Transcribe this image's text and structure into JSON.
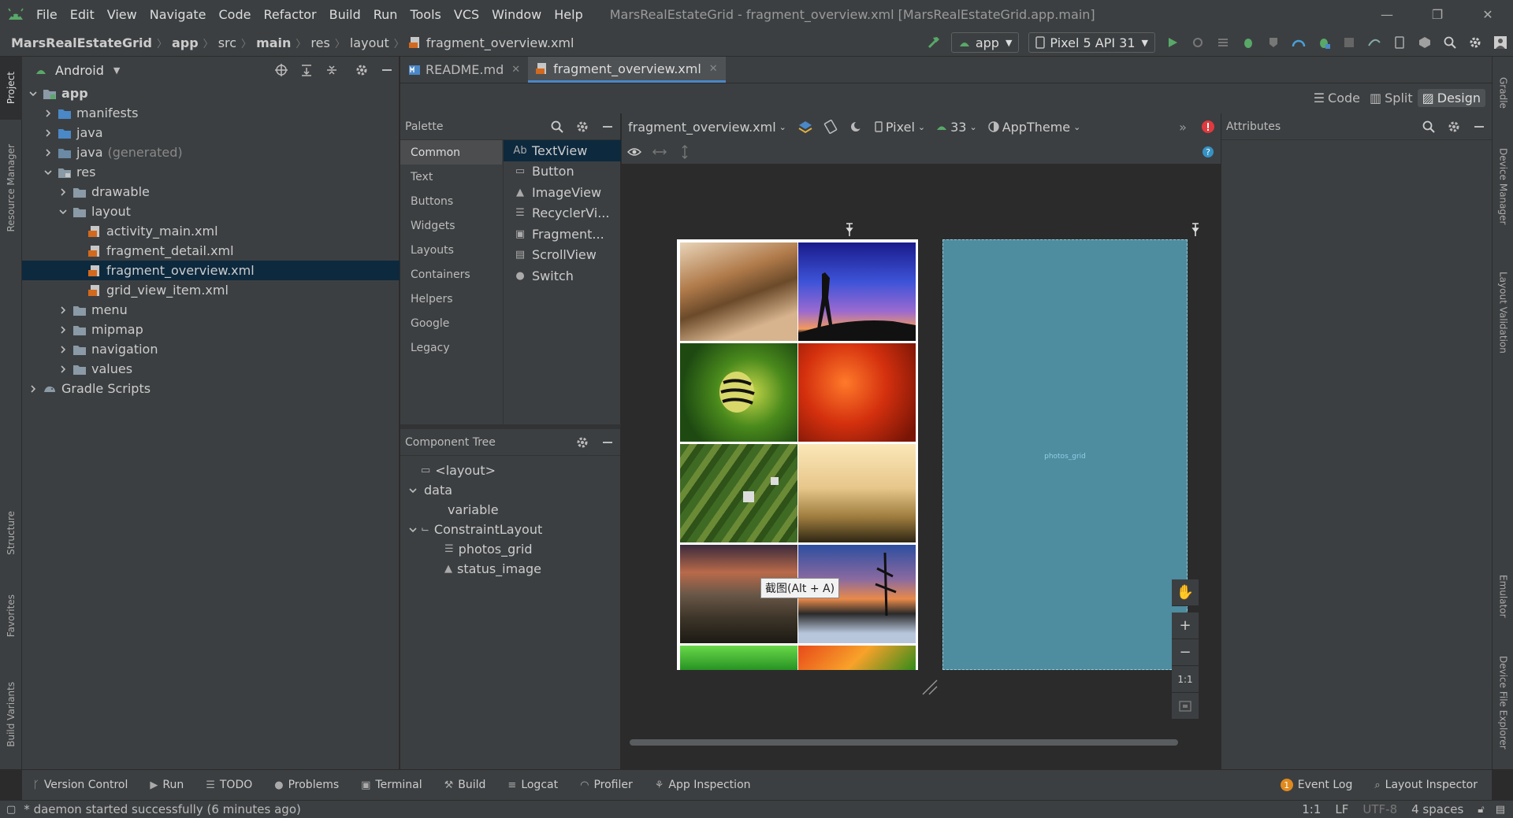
{
  "window": {
    "title": "MarsRealEstateGrid - fragment_overview.xml [MarsRealEstateGrid.app.main]",
    "menu": [
      "File",
      "Edit",
      "View",
      "Navigate",
      "Code",
      "Refactor",
      "Build",
      "Run",
      "Tools",
      "VCS",
      "Window",
      "Help"
    ],
    "controls": [
      "—",
      "❐",
      "✕"
    ]
  },
  "breadcrumbs": [
    "MarsRealEstateGrid",
    "app",
    "src",
    "main",
    "res",
    "layout",
    "fragment_overview.xml"
  ],
  "toolbar": {
    "run_config": "app",
    "device": "Pixel 5 API 31"
  },
  "left_stripe": [
    "Project",
    "Resource Manager",
    "Structure",
    "Favorites",
    "Build Variants"
  ],
  "right_stripe": [
    "Gradle",
    "Device Manager",
    "Layout Validation",
    "Emulator",
    "Device File Explorer"
  ],
  "project": {
    "view": "Android",
    "tree": [
      {
        "label": "app",
        "level": 0,
        "expanded": true,
        "kind": "module"
      },
      {
        "label": "manifests",
        "level": 1,
        "expanded": false,
        "kind": "folder-blue"
      },
      {
        "label": "java",
        "level": 1,
        "expanded": false,
        "kind": "folder-blue"
      },
      {
        "label": "java",
        "suffix": "(generated)",
        "level": 1,
        "expanded": false,
        "kind": "folder-gen"
      },
      {
        "label": "res",
        "level": 1,
        "expanded": true,
        "kind": "folder-res"
      },
      {
        "label": "drawable",
        "level": 2,
        "expanded": false,
        "kind": "folder"
      },
      {
        "label": "layout",
        "level": 2,
        "expanded": true,
        "kind": "folder"
      },
      {
        "label": "activity_main.xml",
        "level": 3,
        "kind": "xml"
      },
      {
        "label": "fragment_detail.xml",
        "level": 3,
        "kind": "xml"
      },
      {
        "label": "fragment_overview.xml",
        "level": 3,
        "kind": "xml",
        "selected": true
      },
      {
        "label": "grid_view_item.xml",
        "level": 3,
        "kind": "xml"
      },
      {
        "label": "menu",
        "level": 2,
        "expanded": false,
        "kind": "folder"
      },
      {
        "label": "mipmap",
        "level": 2,
        "expanded": false,
        "kind": "folder"
      },
      {
        "label": "navigation",
        "level": 2,
        "expanded": false,
        "kind": "folder"
      },
      {
        "label": "values",
        "level": 2,
        "expanded": false,
        "kind": "folder"
      },
      {
        "label": "Gradle Scripts",
        "level": 0,
        "expanded": false,
        "kind": "gradle"
      }
    ]
  },
  "editor_tabs": [
    {
      "label": "README.md",
      "active": false
    },
    {
      "label": "fragment_overview.xml",
      "active": true
    }
  ],
  "modes": [
    "Code",
    "Split",
    "Design"
  ],
  "active_mode": "Design",
  "palette": {
    "title": "Palette",
    "categories": [
      "Common",
      "Text",
      "Buttons",
      "Widgets",
      "Layouts",
      "Containers",
      "Helpers",
      "Google",
      "Legacy"
    ],
    "items": [
      {
        "icon": "Ab",
        "label": "TextView"
      },
      {
        "icon": "▭",
        "label": "Button"
      },
      {
        "icon": "▲",
        "label": "ImageView"
      },
      {
        "icon": "☰",
        "label": "RecyclerVi..."
      },
      {
        "icon": "▣",
        "label": "Fragment..."
      },
      {
        "icon": "▤",
        "label": "ScrollView"
      },
      {
        "icon": "●",
        "label": "Switch"
      }
    ]
  },
  "component_tree": {
    "title": "Component Tree",
    "nodes": [
      {
        "label": "<layout>",
        "level": 0,
        "icon": "▭"
      },
      {
        "label": "data",
        "level": 0,
        "icon": "",
        "expanded": true
      },
      {
        "label": "variable",
        "level": 1,
        "icon": ""
      },
      {
        "label": "ConstraintLayout",
        "level": 0,
        "icon": "⌙",
        "expanded": true
      },
      {
        "label": "photos_grid",
        "level": 1,
        "icon": "☰"
      },
      {
        "label": "status_image",
        "level": 1,
        "icon": "▲"
      }
    ]
  },
  "canvas_toolbar": {
    "file": "fragment_overview.xml",
    "device": "Pixel",
    "api": "33",
    "theme": "AppTheme"
  },
  "blueprint_label": "photos_grid",
  "tooltip": "截图(Alt + A)",
  "zoom": {
    "zoom_in": "+",
    "zoom_out": "−",
    "actual": "1:1"
  },
  "attributes_title": "Attributes",
  "bottom_tools": [
    "Version Control",
    "Run",
    "TODO",
    "Problems",
    "Terminal",
    "Build",
    "Logcat",
    "Profiler",
    "App Inspection"
  ],
  "bottom_right_tools": {
    "event_count": "1",
    "event_log": "Event Log",
    "layout_inspector": "Layout Inspector"
  },
  "status": {
    "message": "* daemon started successfully (6 minutes ago)",
    "position": "1:1",
    "line_sep": "LF",
    "encoding": "UTF-8",
    "indent": "4 spaces"
  },
  "colors": {
    "bg": "#2b2b2b",
    "panel": "#3c3f41",
    "selection": "#0d293e",
    "accent_green": "#59a869",
    "blueprint": "#4e8ca0",
    "error": "#e0393e"
  }
}
